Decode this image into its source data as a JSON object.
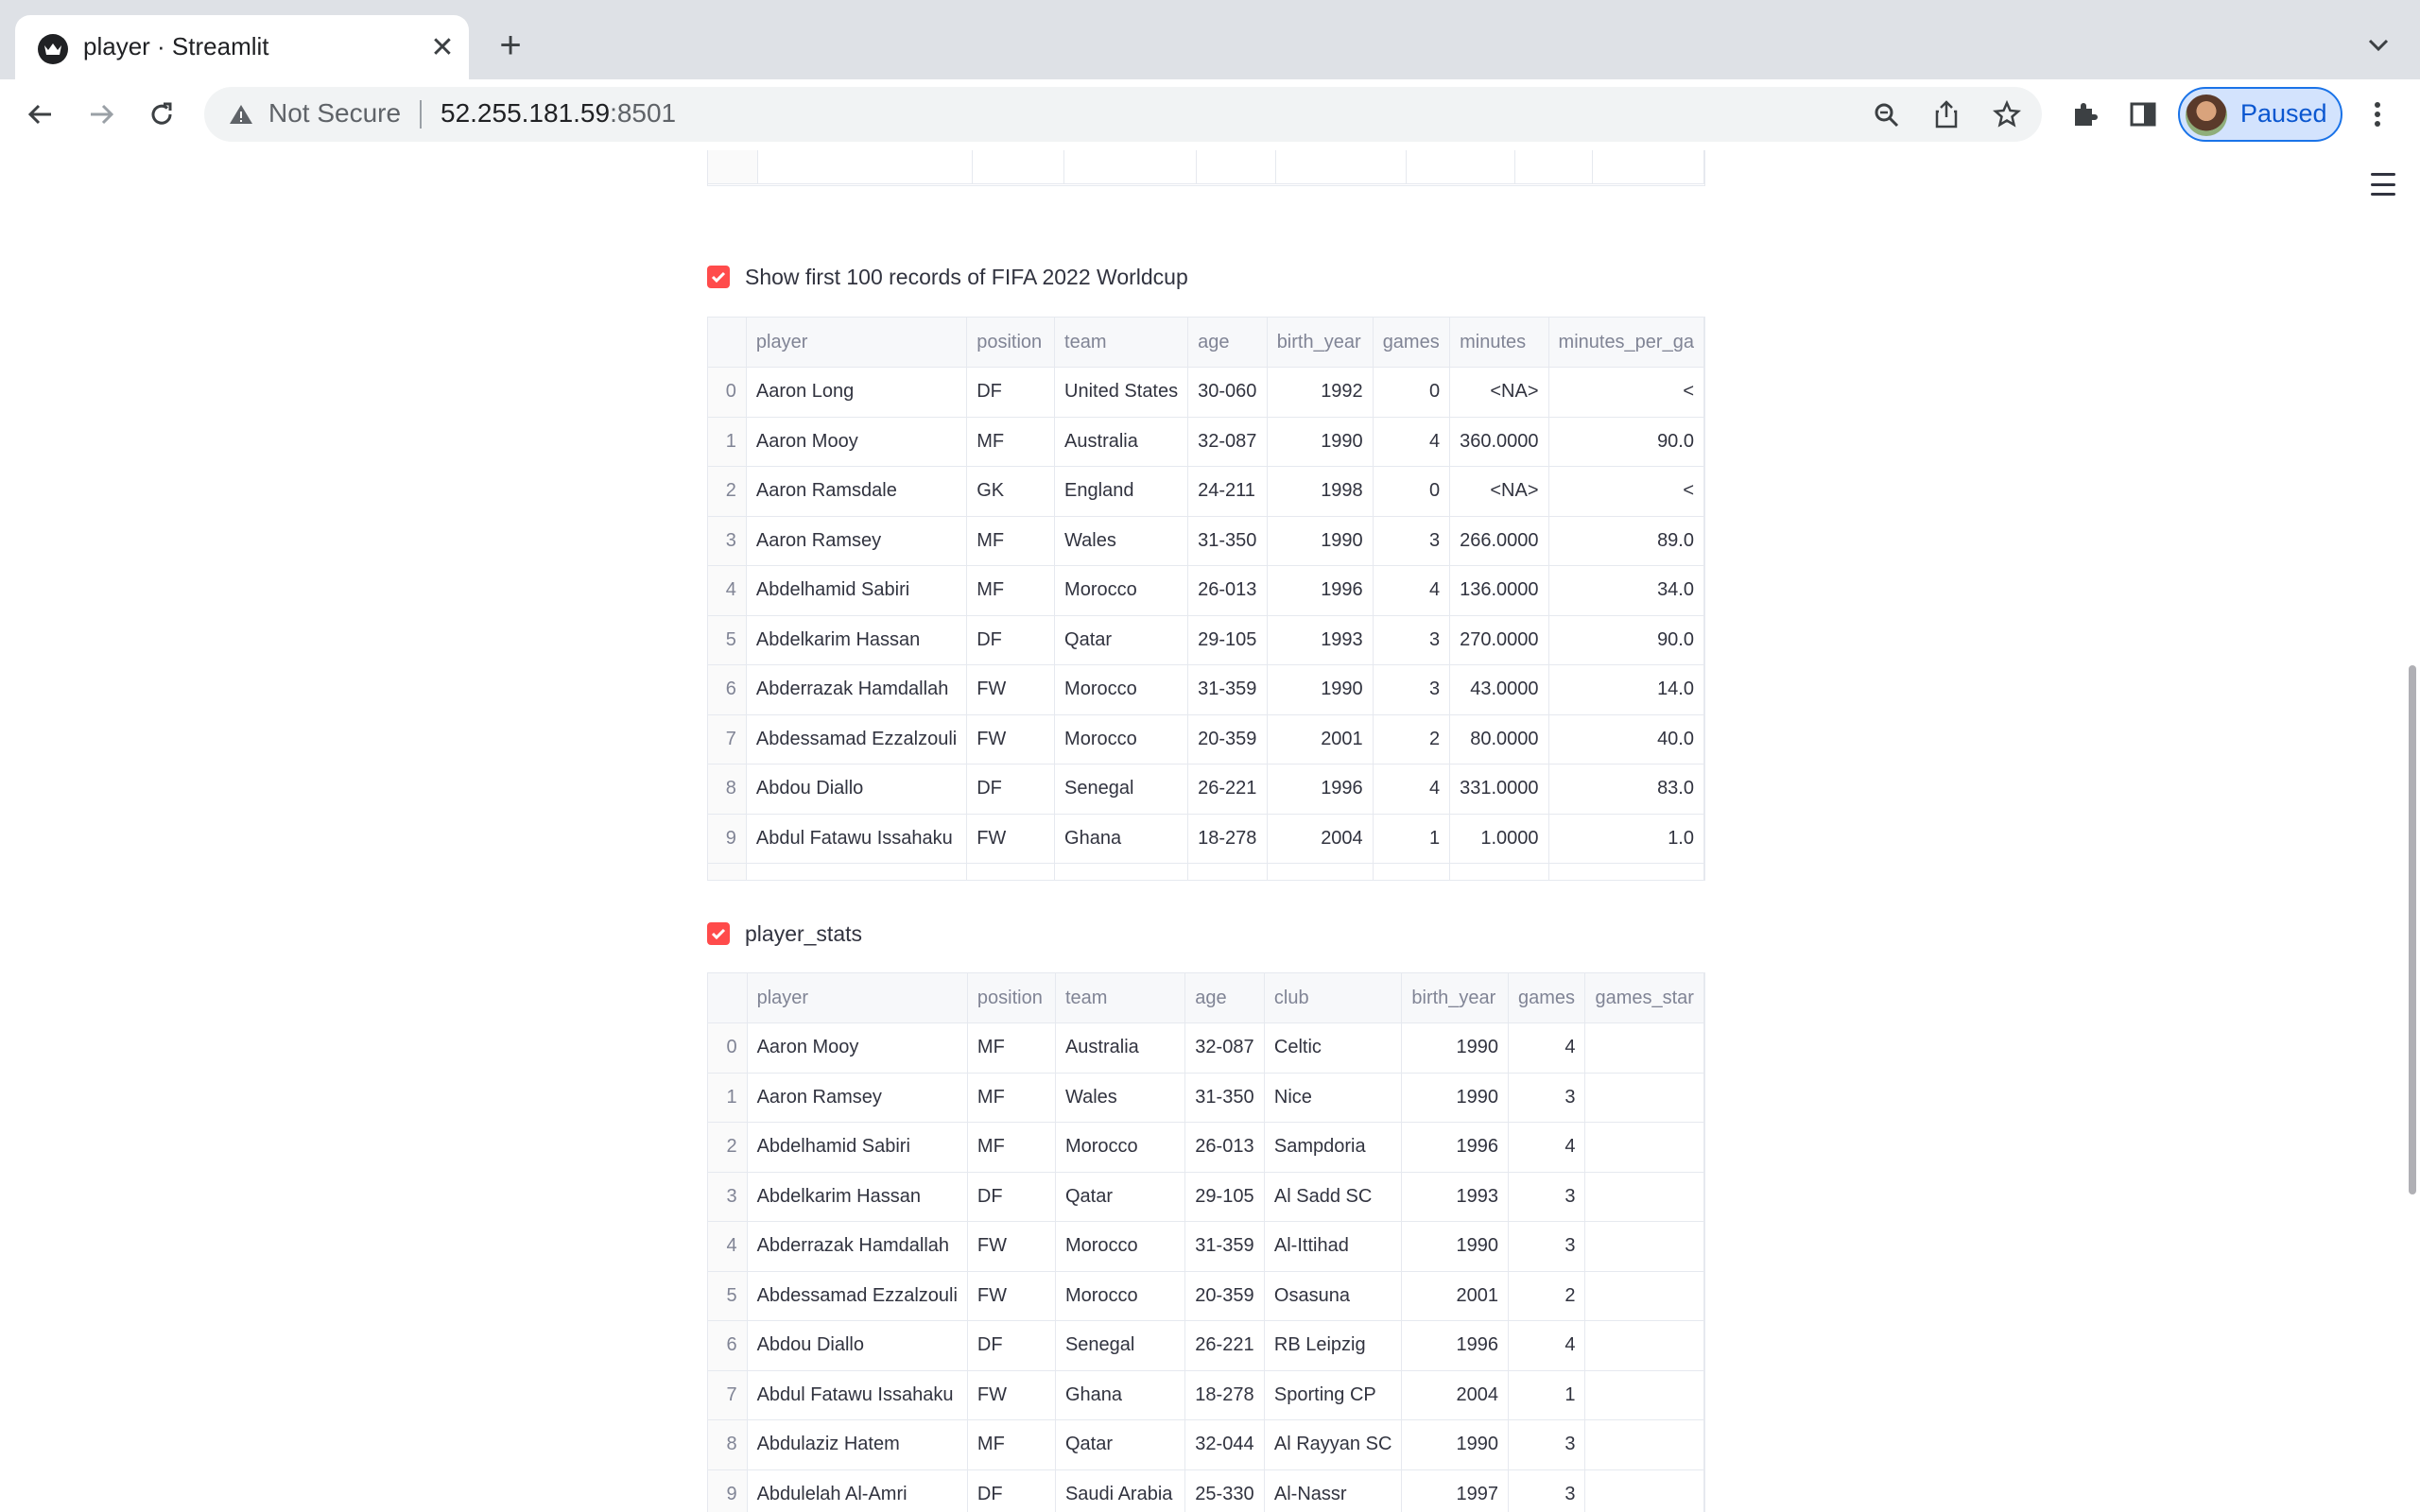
{
  "browser": {
    "tab_title": "player · Streamlit",
    "address_not_secure": "Not Secure",
    "address_host": "52.255.181.59",
    "address_port": ":8501",
    "profile_label": "Paused"
  },
  "section1": {
    "checkbox_label": "Show first 100 records of FIFA 2022 Worldcup",
    "checked": true,
    "columns": [
      "",
      "player",
      "position",
      "team",
      "age",
      "birth_year",
      "games",
      "minutes",
      "minutes_per_ga"
    ],
    "rows": [
      [
        "0",
        "Aaron Long",
        "DF",
        "United States",
        "30-060",
        "1992",
        "0",
        "<NA>",
        "<"
      ],
      [
        "1",
        "Aaron Mooy",
        "MF",
        "Australia",
        "32-087",
        "1990",
        "4",
        "360.0000",
        "90.0"
      ],
      [
        "2",
        "Aaron Ramsdale",
        "GK",
        "England",
        "24-211",
        "1998",
        "0",
        "<NA>",
        "<"
      ],
      [
        "3",
        "Aaron Ramsey",
        "MF",
        "Wales",
        "31-350",
        "1990",
        "3",
        "266.0000",
        "89.0"
      ],
      [
        "4",
        "Abdelhamid Sabiri",
        "MF",
        "Morocco",
        "26-013",
        "1996",
        "4",
        "136.0000",
        "34.0"
      ],
      [
        "5",
        "Abdelkarim Hassan",
        "DF",
        "Qatar",
        "29-105",
        "1993",
        "3",
        "270.0000",
        "90.0"
      ],
      [
        "6",
        "Abderrazak Hamdallah",
        "FW",
        "Morocco",
        "31-359",
        "1990",
        "3",
        "43.0000",
        "14.0"
      ],
      [
        "7",
        "Abdessamad Ezzalzouli",
        "FW",
        "Morocco",
        "20-359",
        "2001",
        "2",
        "80.0000",
        "40.0"
      ],
      [
        "8",
        "Abdou Diallo",
        "DF",
        "Senegal",
        "26-221",
        "1996",
        "4",
        "331.0000",
        "83.0"
      ],
      [
        "9",
        "Abdul Fatawu Issahaku",
        "FW",
        "Ghana",
        "18-278",
        "2004",
        "1",
        "1.0000",
        "1.0"
      ]
    ]
  },
  "section2": {
    "checkbox_label": "player_stats",
    "checked": true,
    "columns": [
      "",
      "player",
      "position",
      "team",
      "age",
      "club",
      "birth_year",
      "games",
      "games_star"
    ],
    "rows": [
      [
        "0",
        "Aaron Mooy",
        "MF",
        "Australia",
        "32-087",
        "Celtic",
        "1990",
        "4",
        ""
      ],
      [
        "1",
        "Aaron Ramsey",
        "MF",
        "Wales",
        "31-350",
        "Nice",
        "1990",
        "3",
        ""
      ],
      [
        "2",
        "Abdelhamid Sabiri",
        "MF",
        "Morocco",
        "26-013",
        "Sampdoria",
        "1996",
        "4",
        ""
      ],
      [
        "3",
        "Abdelkarim Hassan",
        "DF",
        "Qatar",
        "29-105",
        "Al Sadd SC",
        "1993",
        "3",
        ""
      ],
      [
        "4",
        "Abderrazak Hamdallah",
        "FW",
        "Morocco",
        "31-359",
        "Al-Ittihad",
        "1990",
        "3",
        ""
      ],
      [
        "5",
        "Abdessamad Ezzalzouli",
        "FW",
        "Morocco",
        "20-359",
        "Osasuna",
        "2001",
        "2",
        ""
      ],
      [
        "6",
        "Abdou Diallo",
        "DF",
        "Senegal",
        "26-221",
        "RB Leipzig",
        "1996",
        "4",
        ""
      ],
      [
        "7",
        "Abdul Fatawu Issahaku",
        "FW",
        "Ghana",
        "18-278",
        "Sporting CP",
        "2004",
        "1",
        ""
      ],
      [
        "8",
        "Abdulaziz Hatem",
        "MF",
        "Qatar",
        "32-044",
        "Al Rayyan SC",
        "1990",
        "3",
        ""
      ],
      [
        "9",
        "Abdulelah Al-Amri",
        "DF",
        "Saudi Arabia",
        "25-330",
        "Al-Nassr",
        "1997",
        "3",
        ""
      ]
    ]
  }
}
